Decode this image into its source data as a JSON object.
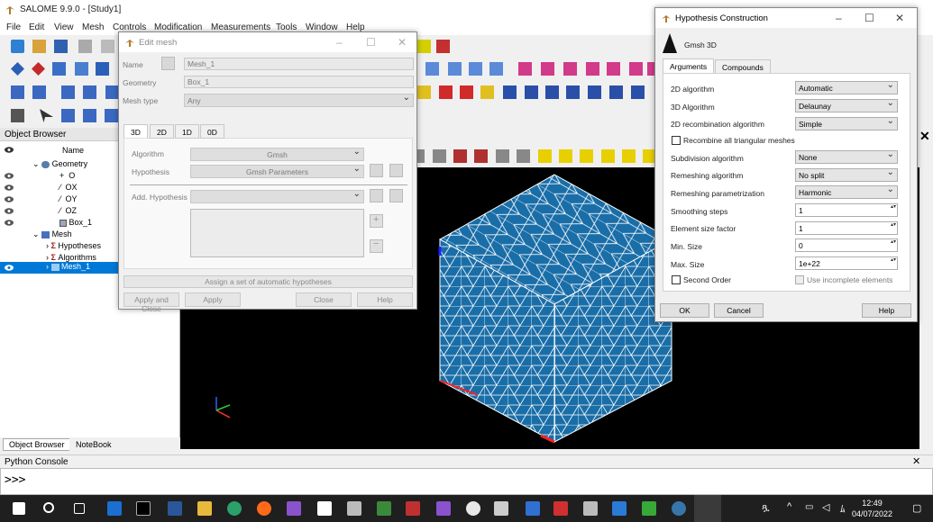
{
  "app": {
    "title": "SALOME 9.9.0 - [Study1]"
  },
  "menu": [
    "File",
    "Edit",
    "View",
    "Mesh",
    "Controls",
    "Modification",
    "Measurements",
    "Tools",
    "Window",
    "Help"
  ],
  "object_browser": {
    "title": "Object Browser",
    "name_header": "Name",
    "items": [
      {
        "label": "Geometry"
      },
      {
        "label": "O"
      },
      {
        "label": "OX"
      },
      {
        "label": "OY"
      },
      {
        "label": "OZ"
      },
      {
        "label": "Box_1"
      },
      {
        "label": "Mesh"
      },
      {
        "label": "Hypotheses"
      },
      {
        "label": "Algorithms"
      },
      {
        "label": "Mesh_1"
      }
    ],
    "tabs": [
      "Object Browser",
      "NoteBook"
    ]
  },
  "python_console": {
    "title": "Python Console",
    "prompt": ">>>"
  },
  "edit_mesh": {
    "title": "Edit mesh",
    "name_label": "Name",
    "name_value": "Mesh_1",
    "geometry_label": "Geometry",
    "geometry_value": "Box_1",
    "mesh_type_label": "Mesh type",
    "mesh_type_value": "Any",
    "tabs": [
      "3D",
      "2D",
      "1D",
      "0D"
    ],
    "algorithm_label": "Algorithm",
    "algorithm_value": "Gmsh",
    "hypothesis_label": "Hypothesis",
    "hypothesis_value": "Gmsh Parameters",
    "add_hypothesis_label": "Add. Hypothesis",
    "assign_button": "Assign a set of automatic hypotheses",
    "apply_close": "Apply and Close",
    "apply": "Apply",
    "close": "Close",
    "help": "Help"
  },
  "hypothesis": {
    "title": "Hypothesis Construction",
    "subtitle": "Gmsh 3D",
    "tabs": [
      "Arguments",
      "Compounds"
    ],
    "rows": [
      {
        "label": "2D algorithm",
        "value": "Automatic"
      },
      {
        "label": "3D Algorithm",
        "value": "Delaunay"
      },
      {
        "label": "2D recombination algorithm",
        "value": "Simple"
      },
      {
        "label": "Subdivision algorithm",
        "value": "None"
      },
      {
        "label": "Remeshing algorithm",
        "value": "No split"
      },
      {
        "label": "Remeshing parametrization",
        "value": "Harmonic"
      },
      {
        "label": "Smoothing steps",
        "value": "1"
      },
      {
        "label": "Element size factor",
        "value": "1"
      },
      {
        "label": "Min. Size",
        "value": "0"
      },
      {
        "label": "Max. Size",
        "value": "1e+22"
      }
    ],
    "recombine_label": "Recombine all triangular meshes",
    "second_order_label": "Second Order",
    "incomplete_label": "Use incomplete elements",
    "ok": "OK",
    "cancel": "Cancel",
    "help": "Help"
  },
  "taskbar": {
    "time": "12:49",
    "date": "04/07/2022"
  },
  "colors": {
    "mesh_face": "#1a6ea8",
    "selection": "#0078d7",
    "viewer_bg": "#000000"
  }
}
